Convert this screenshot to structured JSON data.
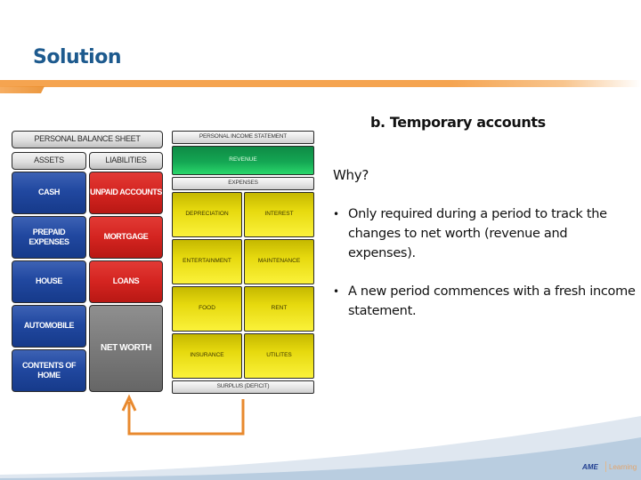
{
  "slide": {
    "title": "Solution",
    "heading": "b. Temporary accounts",
    "question": "Why?",
    "bullets": [
      "Only required during a period to track the changes to net worth (revenue and expenses).",
      "A new period commences with a fresh income statement."
    ]
  },
  "balance_sheet": {
    "title": "PERSONAL BALANCE SHEET",
    "assets_header": "ASSETS",
    "liabilities_header": "LIABILITIES",
    "assets": [
      "CASH",
      "PREPAID EXPENSES",
      "HOUSE",
      "AUTOMOBILE",
      "CONTENTS OF HOME"
    ],
    "liabilities": [
      "UNPAID ACCOUNTS",
      "MORTGAGE",
      "LOANS"
    ],
    "net_worth": "NET WORTH"
  },
  "income_statement": {
    "title": "PERSONAL INCOME STATEMENT",
    "revenue": "REVENUE",
    "expenses_header": "EXPENSES",
    "expenses": [
      "DEPRECIATION",
      "INTEREST",
      "ENTERTAINMENT",
      "MAINTENANCE",
      "FOOD",
      "RENT",
      "INSURANCE",
      "UTILITES"
    ],
    "surplus": "SURPLUS (DEFICIT)"
  },
  "footer": {
    "logo_brand": "AME",
    "logo_text": "Learning"
  },
  "colors": {
    "title": "#1d5a8e",
    "accent_orange": "#f5a450",
    "asset_blue": "#2148a0",
    "liability_red": "#d42420",
    "revenue_green": "#14a653",
    "expense_yellow": "#e6d90e",
    "arrow_orange": "#e8892e"
  }
}
